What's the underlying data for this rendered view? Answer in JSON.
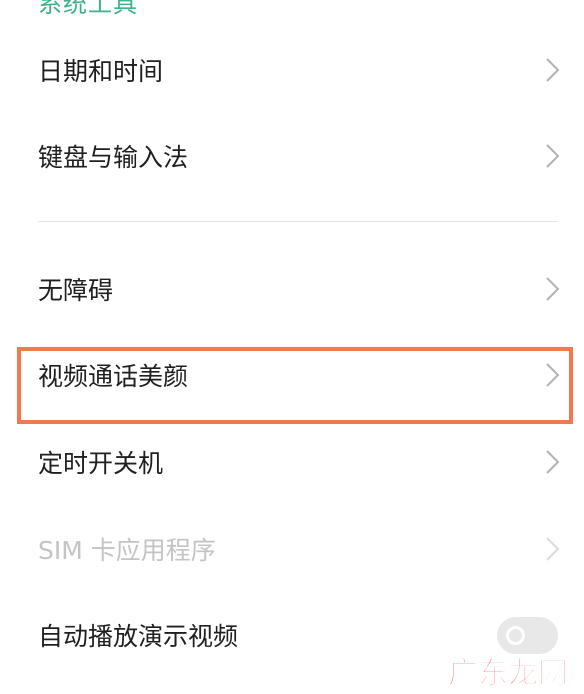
{
  "header_cut": "系统工具",
  "rows": [
    {
      "label": "日期和时间",
      "enabled": true
    },
    {
      "label": "键盘与输入法",
      "enabled": true
    },
    {
      "label": "无障碍",
      "enabled": true
    },
    {
      "label": "视频通话美颜",
      "enabled": true,
      "highlighted": true
    },
    {
      "label": "定时开关机",
      "enabled": true
    },
    {
      "label": "SIM 卡应用程序",
      "enabled": false
    },
    {
      "label": "自动播放演示视频",
      "enabled": true,
      "toggle": "off"
    }
  ],
  "watermark": "广东龙网",
  "colors": {
    "highlight_border": "#f07a4f",
    "text": "#1f1f1f",
    "disabled_text": "#c4c4c4",
    "chevron": "#b3b3b3",
    "watermark": "#e6463a"
  }
}
